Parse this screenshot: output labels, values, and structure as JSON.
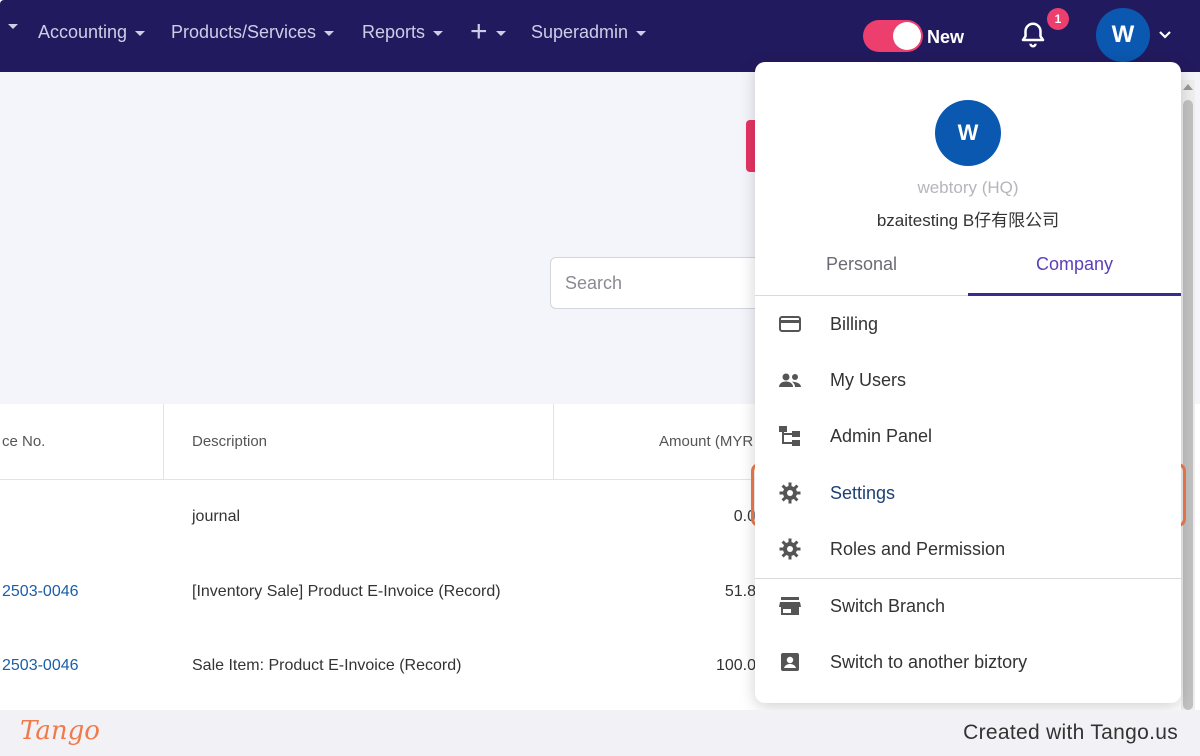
{
  "nav": {
    "items": [
      {
        "label": ""
      },
      {
        "label": "Accounting"
      },
      {
        "label": "Products/Services"
      },
      {
        "label": "Reports"
      },
      {
        "label": "+"
      },
      {
        "label": "Superadmin"
      }
    ],
    "toggle_label": "New",
    "notification_count": "1",
    "avatar_initial": "W"
  },
  "search": {
    "placeholder": "Search"
  },
  "table": {
    "headers": [
      "ce No.",
      "Description",
      "Amount (MYR"
    ],
    "rows": [
      {
        "no": "",
        "description": "journal",
        "amount": "0.0"
      },
      {
        "no": "2503-0046",
        "description": "[Inventory Sale] Product E-Invoice (Record)",
        "amount": "51.8"
      },
      {
        "no": "2503-0046",
        "description": "Sale Item: Product E-Invoice (Record)",
        "amount": "100.0"
      }
    ]
  },
  "menu": {
    "avatar_initial": "W",
    "company": "webtory (HQ)",
    "user": "bzaitesting B仔有限公司",
    "tabs": {
      "personal": "Personal",
      "company": "Company"
    },
    "items": [
      {
        "label": "Billing",
        "icon": "credit-card-icon"
      },
      {
        "label": "My Users",
        "icon": "users-icon"
      },
      {
        "label": "Admin Panel",
        "icon": "hierarchy-icon"
      },
      {
        "label": "Settings",
        "icon": "gear-icon"
      },
      {
        "label": "Roles and Permission",
        "icon": "gear-icon"
      },
      {
        "label": "Switch Branch",
        "icon": "store-icon"
      },
      {
        "label": "Switch to another biztory",
        "icon": "account-box-icon"
      }
    ]
  },
  "footer": {
    "logo": "Tango",
    "text": "Created with Tango.us"
  },
  "colors": {
    "nav_bg": "#221a5e",
    "accent_pink": "#ec3f6d",
    "avatar_blue": "#0b58b0",
    "tab_active": "#5b3fb8",
    "highlight": "#f07a4a"
  }
}
